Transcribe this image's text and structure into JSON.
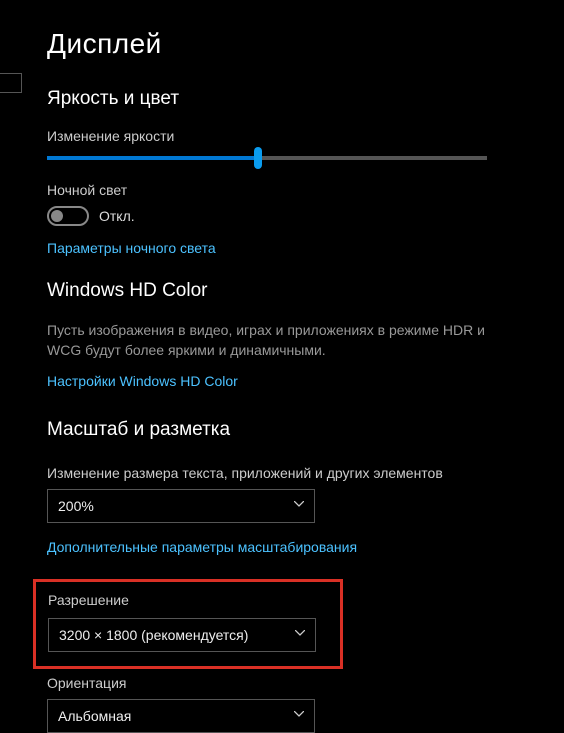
{
  "page": {
    "title": "Дисплей"
  },
  "brightness": {
    "heading": "Яркость и цвет",
    "slider_label": "Изменение яркости",
    "slider_percent": 48,
    "nightlight_label": "Ночной свет",
    "nightlight_state": "Откл.",
    "nightlight_link": "Параметры ночного света"
  },
  "hdcolor": {
    "heading": "Windows HD Color",
    "description": "Пусть изображения в видео, играх и приложениях в режиме HDR и WCG будут более яркими и динамичными.",
    "link": "Настройки Windows HD Color"
  },
  "scale": {
    "heading": "Масштаб и разметка",
    "size_label": "Изменение размера текста, приложений и других элементов",
    "size_value": "200%",
    "advanced_link": "Дополнительные параметры масштабирования",
    "resolution_label": "Разрешение",
    "resolution_value": "3200 × 1800 (рекомендуется)",
    "orientation_label": "Ориентация",
    "orientation_value": "Альбомная"
  },
  "colors": {
    "accent": "#0078d4",
    "link": "#4cc2ff",
    "highlight": "#d93025"
  }
}
